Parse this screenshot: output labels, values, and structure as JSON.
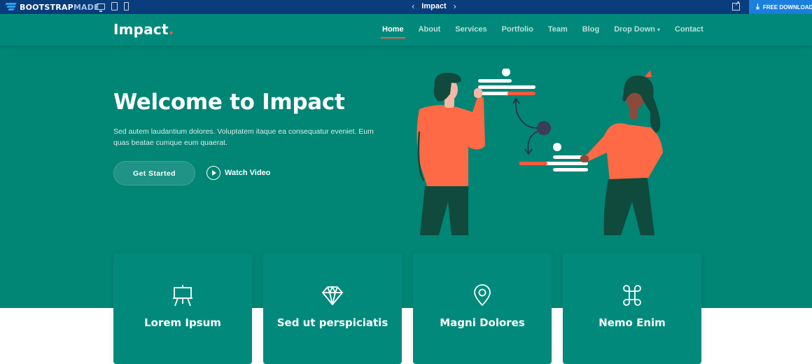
{
  "preview_bar": {
    "brand_part1": "BOOTSTRAP",
    "brand_part2": "MADE",
    "title": "Impact",
    "prev_glyph": "‹",
    "next_glyph": "›",
    "download_label": "FREE DOWNLOAD",
    "colors": {
      "background": "#0a3d7c",
      "download": "#1b7fe0"
    }
  },
  "header": {
    "logo_text": "Impact",
    "logo_dot": ".",
    "nav": [
      {
        "label": "Home",
        "active": true
      },
      {
        "label": "About"
      },
      {
        "label": "Services"
      },
      {
        "label": "Portfolio"
      },
      {
        "label": "Team"
      },
      {
        "label": "Blog"
      },
      {
        "label": "Drop Down",
        "dropdown": true
      },
      {
        "label": "Contact"
      }
    ]
  },
  "hero": {
    "title": "Welcome to Impact",
    "text": "Sed autem laudantium dolores. Voluptatem itaque ea consequatur eveniet. Eum quas beatae cumque eum quaerat.",
    "cta_label": "Get Started",
    "video_label": "Watch Video"
  },
  "cards": [
    {
      "title": "Lorem Ipsum",
      "icon": "easel-icon"
    },
    {
      "title": "Sed ut perspiciatis",
      "icon": "gem-icon"
    },
    {
      "title": "Magni Dolores",
      "icon": "geo-pin-icon"
    },
    {
      "title": "Nemo Enim",
      "icon": "command-icon"
    }
  ],
  "colors": {
    "primary": "#008374",
    "accent": "#f85a40",
    "person_shirt": "#fe6a45",
    "person_pants": "#0f4a3c",
    "hair": "#104a3c"
  }
}
